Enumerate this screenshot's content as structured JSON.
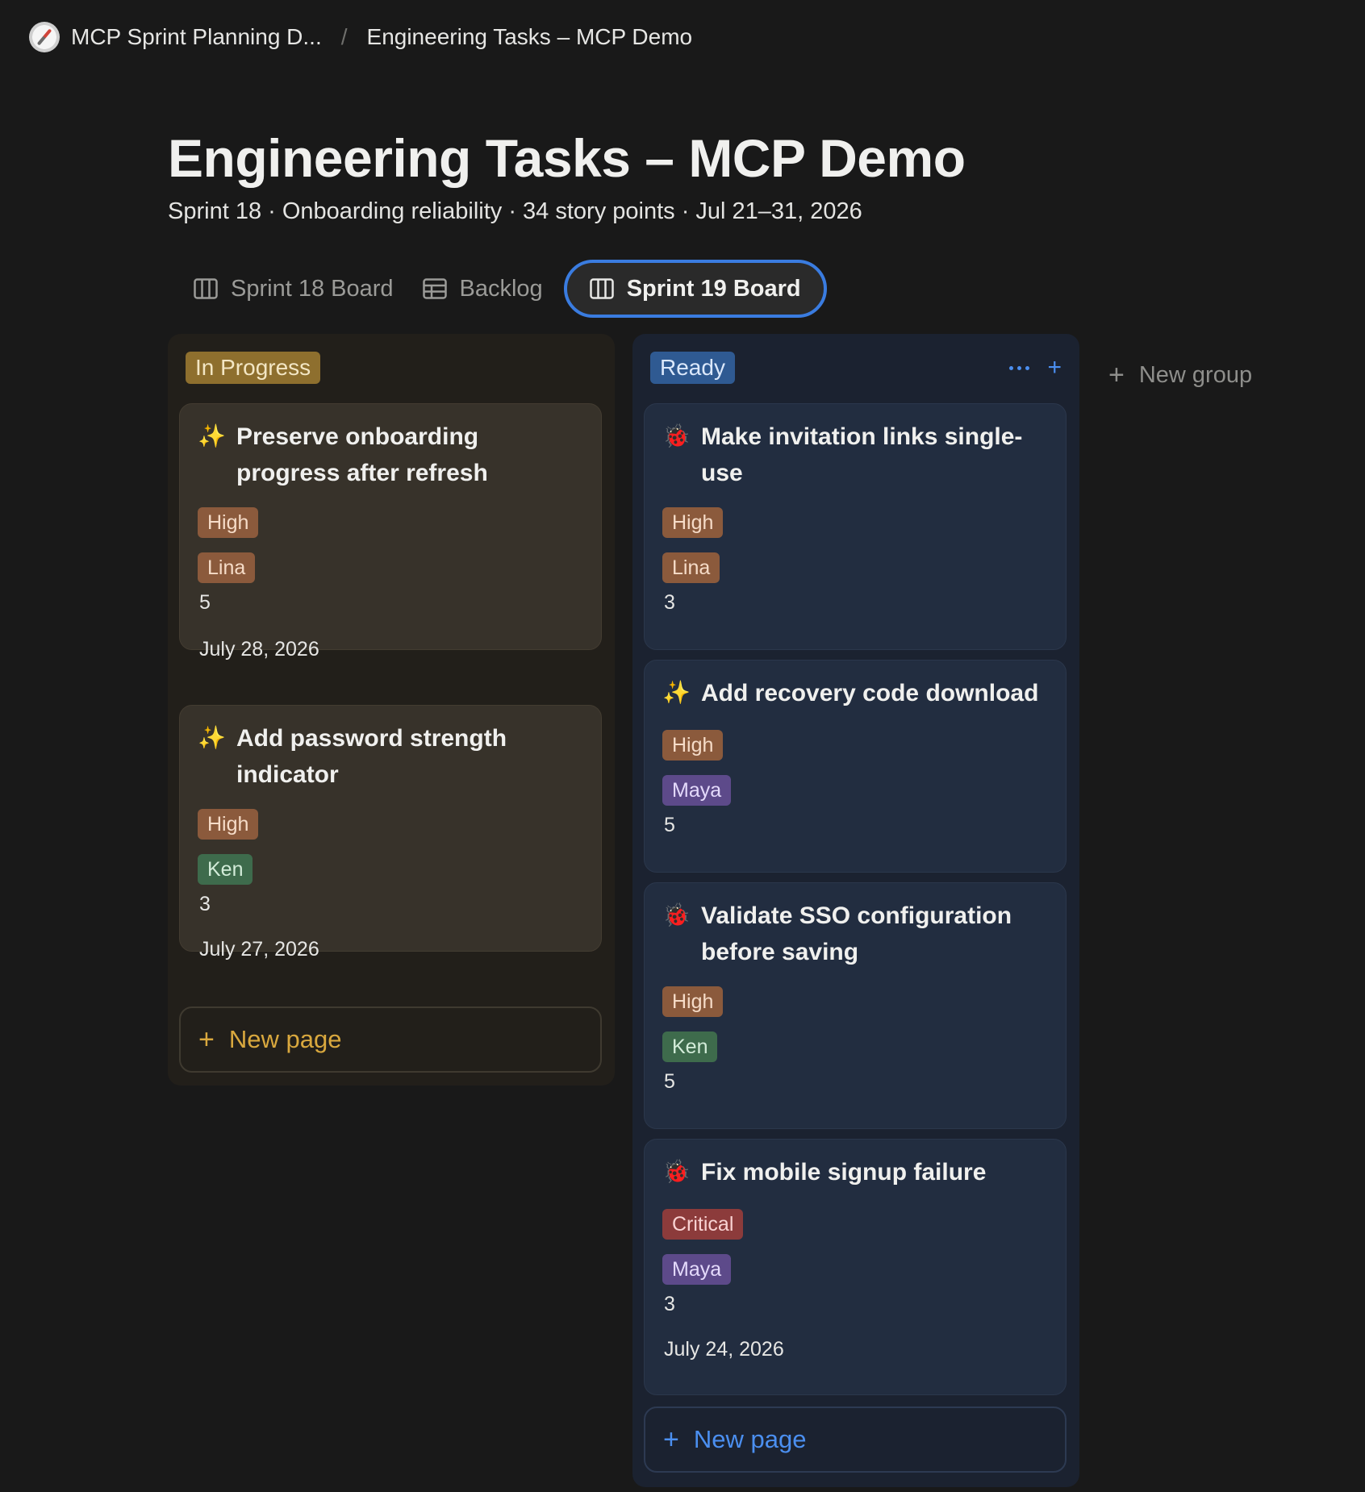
{
  "breadcrumb": {
    "parent": "MCP Sprint Planning D...",
    "current": "Engineering Tasks – MCP Demo"
  },
  "page": {
    "title": "Engineering Tasks – MCP Demo",
    "subtitle": "Sprint 18 · Onboarding reliability · 34 story points · Jul 21–31, 2026"
  },
  "tabs": [
    {
      "label": "Sprint 18 Board",
      "icon": "board-icon",
      "active": false
    },
    {
      "label": "Backlog",
      "icon": "table-icon",
      "active": false
    },
    {
      "label": "Sprint 19 Board",
      "icon": "board-icon",
      "active": true
    }
  ],
  "columns": {
    "in_progress": {
      "label": "In Progress",
      "color": "#8e6f2e",
      "cards": [
        {
          "icon": "sparkles-icon",
          "title": "Preserve onboarding progress after refresh",
          "priority": "High",
          "assignee": "Lina",
          "points": "5",
          "date": "July 28, 2026"
        },
        {
          "icon": "sparkles-icon",
          "title": "Add password strength indicator",
          "priority": "High",
          "assignee": "Ken",
          "points": "3",
          "date": "July 27, 2026"
        }
      ],
      "new_page": "New page"
    },
    "ready": {
      "label": "Ready",
      "color": "#2f5a92",
      "cards": [
        {
          "icon": "bug-icon",
          "title": "Make invitation links single-use",
          "priority": "High",
          "assignee": "Lina",
          "points": "3"
        },
        {
          "icon": "sparkles-icon",
          "title": "Add recovery code download",
          "priority": "High",
          "assignee": "Maya",
          "points": "5"
        },
        {
          "icon": "bug-icon",
          "title": "Validate SSO configuration before saving",
          "priority": "High",
          "assignee": "Ken",
          "points": "5"
        },
        {
          "icon": "bug-icon",
          "title": "Fix mobile signup failure",
          "priority": "Critical",
          "assignee": "Maya",
          "points": "3",
          "date": "July 24, 2026"
        }
      ],
      "new_page": "New page"
    }
  },
  "new_group": "New group",
  "colors": {
    "accent": "#3a7ce0",
    "background": "#191919"
  }
}
